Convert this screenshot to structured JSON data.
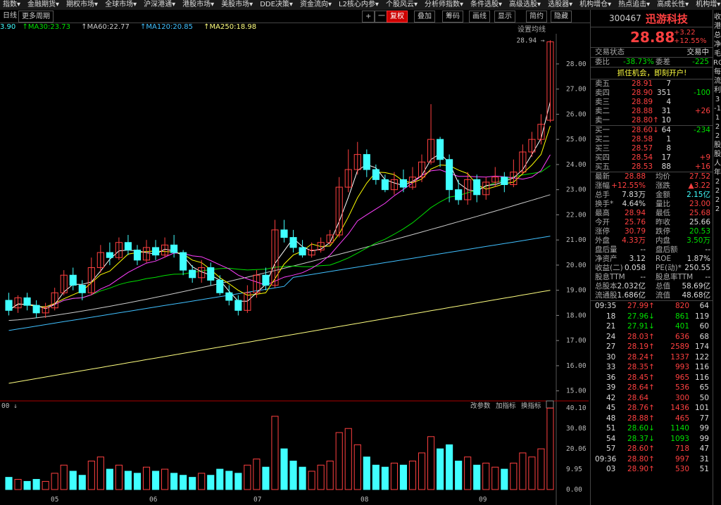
{
  "menu": [
    "指数",
    "金融期货",
    "期权市场",
    "全球市场",
    "沪深港通",
    "港股市场",
    "美股市场",
    "DDE决策",
    "资金流向",
    "L2核心内参",
    "个股风云",
    "分析师指数",
    "条件选股",
    "高级选股",
    "选股器",
    "机构增仓",
    "热点追击",
    "高成长性",
    "机构增"
  ],
  "toolbar": {
    "period_label": "日线",
    "more_periods": "更多周期",
    "plus": "+",
    "minus": "一",
    "fuquan": "复权",
    "overlay": "叠加",
    "chip": "筹码",
    "draw": "画线",
    "display": "显示",
    "brief": "简约",
    "hide": "隐藏"
  },
  "ma": {
    "ma_prefix": "3.90",
    "ma30": "MA30:23.73",
    "ma60": "MA60:22.77",
    "ma120": "MA120:20.85",
    "ma250": "MA250:18.98",
    "settings": "设置均线"
  },
  "chart_labels": {
    "high_marker": "28.94",
    "vol_prefix": "00",
    "vol_tools": [
      "改参数",
      "加指标",
      "换指标"
    ],
    "months": [
      "05",
      "06",
      "07",
      "08",
      "09"
    ]
  },
  "chart_data": {
    "type": "candlestick",
    "price_axis": {
      "ticks": [
        28.0,
        27.0,
        26.0,
        25.0,
        24.0,
        23.0,
        22.0,
        21.0,
        20.0,
        19.0,
        18.0,
        17.0,
        16.0,
        15.0
      ],
      "ylim": [
        14.6,
        29.2
      ]
    },
    "volume_axis": {
      "ticks": [
        "40.10",
        "30.08",
        "20.06",
        "9.95",
        "0.00"
      ],
      "ylim": [
        0,
        40.1
      ]
    },
    "ma_colors": {
      "ma5": "#ffffff",
      "ma10": "#ffff00",
      "ma20": "#ff40ff",
      "ma30": "#00e000",
      "ma60": "#cccccc",
      "ma120": "#40c0ff",
      "ma250": "#ffff80"
    },
    "candles": [
      [
        18.6,
        18.2,
        18.9,
        18.0
      ],
      [
        18.3,
        18.7,
        18.8,
        18.1
      ],
      [
        18.7,
        18.4,
        18.9,
        18.2
      ],
      [
        18.4,
        18.1,
        18.6,
        17.9
      ],
      [
        18.1,
        18.3,
        18.5,
        17.9
      ],
      [
        18.3,
        18.9,
        19.1,
        18.2
      ],
      [
        18.9,
        19.6,
        19.8,
        18.8
      ],
      [
        19.6,
        19.2,
        19.9,
        19.0
      ],
      [
        19.2,
        18.9,
        19.4,
        18.6
      ],
      [
        18.9,
        19.9,
        20.3,
        18.8
      ],
      [
        19.9,
        20.5,
        20.8,
        19.7
      ],
      [
        20.5,
        20.3,
        20.9,
        20.0
      ],
      [
        20.3,
        20.9,
        21.1,
        20.2
      ],
      [
        20.9,
        20.6,
        21.2,
        20.4
      ],
      [
        20.6,
        20.2,
        20.8,
        20.0
      ],
      [
        20.2,
        20.7,
        21.0,
        20.1
      ],
      [
        20.7,
        20.4,
        21.0,
        20.2
      ],
      [
        20.4,
        20.8,
        21.1,
        20.3
      ],
      [
        20.8,
        20.5,
        21.2,
        20.3
      ],
      [
        20.5,
        19.8,
        20.6,
        19.6
      ],
      [
        19.8,
        19.5,
        20.0,
        19.3
      ],
      [
        19.5,
        19.9,
        20.2,
        19.3
      ],
      [
        19.9,
        19.4,
        20.1,
        19.2
      ],
      [
        19.4,
        18.9,
        19.6,
        18.8
      ],
      [
        18.9,
        18.6,
        19.2,
        18.4
      ],
      [
        18.6,
        18.2,
        18.8,
        18.0
      ],
      [
        18.2,
        18.9,
        19.2,
        18.1
      ],
      [
        18.9,
        19.6,
        19.8,
        18.7
      ],
      [
        19.6,
        19.2,
        19.9,
        19.0
      ],
      [
        19.2,
        21.4,
        21.8,
        19.1
      ],
      [
        21.4,
        21.1,
        21.8,
        20.9
      ],
      [
        21.1,
        20.7,
        21.4,
        20.5
      ],
      [
        20.7,
        20.4,
        21.0,
        20.3
      ],
      [
        20.4,
        20.6,
        20.9,
        20.3
      ],
      [
        20.6,
        20.9,
        21.1,
        20.5
      ],
      [
        20.9,
        21.2,
        21.4,
        20.8
      ],
      [
        21.2,
        23.1,
        23.5,
        21.1
      ],
      [
        23.1,
        23.8,
        24.6,
        22.9
      ],
      [
        23.8,
        24.4,
        24.9,
        23.6
      ],
      [
        24.4,
        23.8,
        24.6,
        23.5
      ],
      [
        23.8,
        23.4,
        24.0,
        23.2
      ],
      [
        23.4,
        23.0,
        23.6,
        22.9
      ],
      [
        23.0,
        23.4,
        23.7,
        22.8
      ],
      [
        23.4,
        23.1,
        23.8,
        22.9
      ],
      [
        23.1,
        23.5,
        23.9,
        23.0
      ],
      [
        23.5,
        24.1,
        24.4,
        23.3
      ],
      [
        24.1,
        25.0,
        26.4,
        24.0
      ],
      [
        25.0,
        24.2,
        25.1,
        23.9
      ],
      [
        24.2,
        23.0,
        24.4,
        22.5
      ],
      [
        23.0,
        22.6,
        23.4,
        22.4
      ],
      [
        22.6,
        23.4,
        23.7,
        22.4
      ],
      [
        23.4,
        22.8,
        23.6,
        22.5
      ],
      [
        22.8,
        23.3,
        23.5,
        22.6
      ],
      [
        23.3,
        23.5,
        23.9,
        23.1
      ],
      [
        23.5,
        23.2,
        23.7,
        22.9
      ],
      [
        23.2,
        23.7,
        24.2,
        23.1
      ],
      [
        23.7,
        24.5,
        24.8,
        23.6
      ],
      [
        24.5,
        25.0,
        25.3,
        24.3
      ],
      [
        25.0,
        25.6,
        26.0,
        24.8
      ],
      [
        25.76,
        28.88,
        28.94,
        25.68
      ]
    ],
    "volumes": [
      6,
      5,
      4,
      5,
      4,
      8,
      12,
      9,
      7,
      14,
      16,
      10,
      12,
      9,
      8,
      11,
      9,
      10,
      8,
      7,
      6,
      8,
      7,
      10,
      9,
      8,
      12,
      15,
      11,
      36,
      20,
      14,
      11,
      9,
      12,
      14,
      28,
      30,
      22,
      16,
      12,
      11,
      13,
      12,
      14,
      18,
      26,
      20,
      22,
      14,
      16,
      12,
      13,
      11,
      10,
      13,
      18,
      16,
      20,
      40
    ]
  },
  "quote": {
    "code": "300467",
    "name": "迅游科技",
    "price": "28.88",
    "change": "+3.22",
    "pct": "+12.55%",
    "status_label": "交易状态",
    "status_value": "交易中",
    "weibi_label": "委比",
    "weibi": "-38.73%",
    "weicha_label": "委差",
    "weicha": "-225",
    "promo": "抓住机会，即刻开户!",
    "asks": [
      {
        "label": "卖五",
        "price": "28.91",
        "vol": "7",
        "chg": ""
      },
      {
        "label": "卖四",
        "price": "28.90",
        "vol": "351",
        "chg": "-100"
      },
      {
        "label": "卖三",
        "price": "28.89",
        "vol": "4",
        "chg": ""
      },
      {
        "label": "卖二",
        "price": "28.88",
        "vol": "31",
        "chg": "+26"
      },
      {
        "label": "卖一",
        "price": "28.80↑",
        "vol": "10",
        "chg": ""
      }
    ],
    "bids": [
      {
        "label": "买一",
        "price": "28.60↓",
        "vol": "64",
        "chg": "-234"
      },
      {
        "label": "买二",
        "price": "28.58",
        "vol": "1",
        "chg": ""
      },
      {
        "label": "买三",
        "price": "28.57",
        "vol": "8",
        "chg": ""
      },
      {
        "label": "买四",
        "price": "28.54",
        "vol": "17",
        "chg": "+9"
      },
      {
        "label": "买五",
        "price": "28.53",
        "vol": "88",
        "chg": "+16"
      }
    ],
    "stats": [
      {
        "l1": "最新",
        "v1": "28.88",
        "c1": "red",
        "l2": "均价",
        "v2": "27.52",
        "c2": "red"
      },
      {
        "l1": "涨幅",
        "v1": "+12.55%",
        "c1": "red",
        "l2": "涨跌",
        "v2": "▲3.22",
        "c2": "red"
      },
      {
        "l1": "总手",
        "v1": "7.83万",
        "c1": "white",
        "l2": "金额",
        "v2": "2.15亿",
        "c2": "cyan"
      },
      {
        "l1": "换手*",
        "v1": "4.64%",
        "c1": "white",
        "l2": "量比",
        "v2": "23.00",
        "c2": "red"
      },
      {
        "l1": "最高",
        "v1": "28.94",
        "c1": "red",
        "l2": "最低",
        "v2": "25.68",
        "c2": "red"
      },
      {
        "l1": "今开",
        "v1": "25.76",
        "c1": "red",
        "l2": "昨收",
        "v2": "25.66",
        "c2": "white"
      },
      {
        "l1": "涨停",
        "v1": "30.79",
        "c1": "red",
        "l2": "跌停",
        "v2": "20.53",
        "c2": "green"
      },
      {
        "l1": "外盘",
        "v1": "4.33万",
        "c1": "red",
        "l2": "内盘",
        "v2": "3.50万",
        "c2": "green"
      },
      {
        "l1": "盘后量",
        "v1": "--",
        "c1": "white",
        "l2": "盘后额",
        "v2": "--",
        "c2": "white"
      },
      {
        "l1": "净资产",
        "v1": "3.12",
        "c1": "white",
        "l2": "ROE",
        "v2": "1.87%",
        "c2": "white"
      },
      {
        "l1": "收益(二)",
        "v1": "0.058",
        "c1": "white",
        "l2": "PE(动)*",
        "v2": "250.55",
        "c2": "white"
      },
      {
        "l1": "股息TTM",
        "v1": "--",
        "c1": "white",
        "l2": "股息率TTM",
        "v2": "--",
        "c2": "white"
      },
      {
        "l1": "总股本",
        "v1": "2.032亿",
        "c1": "white",
        "l2": "总值",
        "v2": "58.69亿",
        "c2": "white"
      },
      {
        "l1": "流通股",
        "v1": "1.686亿",
        "c1": "white",
        "l2": "流值",
        "v2": "48.68亿",
        "c2": "white"
      }
    ],
    "ticks": [
      {
        "t": "09:35",
        "p": "27.99↑",
        "pc": "red",
        "v": "820",
        "vc": "red",
        "n": "64"
      },
      {
        "t": "18",
        "p": "27.96↓",
        "pc": "green",
        "v": "861",
        "vc": "green",
        "n": "119"
      },
      {
        "t": "21",
        "p": "27.91↓",
        "pc": "green",
        "v": "401",
        "vc": "green",
        "n": "60"
      },
      {
        "t": "24",
        "p": "28.03↑",
        "pc": "red",
        "v": "636",
        "vc": "red",
        "n": "68"
      },
      {
        "t": "27",
        "p": "28.19↑",
        "pc": "red",
        "v": "2589",
        "vc": "red",
        "n": "174"
      },
      {
        "t": "30",
        "p": "28.24↑",
        "pc": "red",
        "v": "1337",
        "vc": "red",
        "n": "122"
      },
      {
        "t": "33",
        "p": "28.35↑",
        "pc": "red",
        "v": "993",
        "vc": "red",
        "n": "116"
      },
      {
        "t": "36",
        "p": "28.45↑",
        "pc": "red",
        "v": "965",
        "vc": "red",
        "n": "116"
      },
      {
        "t": "39",
        "p": "28.64↑",
        "pc": "red",
        "v": "536",
        "vc": "red",
        "n": "65"
      },
      {
        "t": "42",
        "p": "28.64",
        "pc": "red",
        "v": "300",
        "vc": "red",
        "n": "50"
      },
      {
        "t": "45",
        "p": "28.76↑",
        "pc": "red",
        "v": "1436",
        "vc": "red",
        "n": "101"
      },
      {
        "t": "48",
        "p": "28.88↑",
        "pc": "red",
        "v": "465",
        "vc": "red",
        "n": "77"
      },
      {
        "t": "51",
        "p": "28.60↓",
        "pc": "green",
        "v": "1140",
        "vc": "green",
        "n": "99"
      },
      {
        "t": "54",
        "p": "28.37↓",
        "pc": "green",
        "v": "1093",
        "vc": "green",
        "n": "99"
      },
      {
        "t": "57",
        "p": "28.60↑",
        "pc": "red",
        "v": "718",
        "vc": "red",
        "n": "47"
      },
      {
        "t": "09:36",
        "p": "28.80↑",
        "pc": "red",
        "v": "997",
        "vc": "red",
        "n": "31"
      },
      {
        "t": "03",
        "p": "28.90↑",
        "pc": "red",
        "v": "530",
        "vc": "red",
        "n": "51"
      }
    ]
  },
  "right_edge": [
    "收",
    "港",
    "总",
    "净",
    "毛",
    "ROE",
    "每",
    "流",
    "利",
    "3",
    "-1",
    "1",
    "2",
    "2",
    "股",
    "股",
    "人",
    "年",
    "2",
    "2",
    "2",
    "2"
  ]
}
